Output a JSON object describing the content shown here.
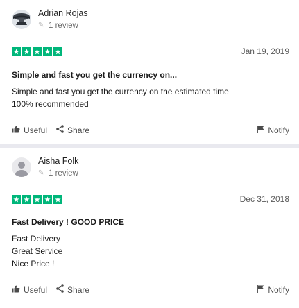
{
  "reviews": [
    {
      "name": "Adrian Rojas",
      "review_count": "1 review",
      "date": "Jan 19, 2019",
      "title": "Simple and fast you get the currency on...",
      "body": [
        "Simple and fast you get the currency on the estimated time",
        "100% recommended"
      ],
      "stars": 5,
      "avatar": "photo"
    },
    {
      "name": "Aisha Folk",
      "review_count": "1 review",
      "date": "Dec 31, 2018",
      "title": "Fast Delivery ! GOOD PRICE",
      "body": [
        "Fast Delivery",
        "Great Service",
        "Nice Price !"
      ],
      "stars": 5,
      "avatar": "default-user"
    }
  ],
  "actions": {
    "useful": "Useful",
    "share": "Share",
    "notify": "Notify"
  },
  "colors": {
    "star_green": "#00b67a",
    "separator": "#e9e9ef"
  }
}
